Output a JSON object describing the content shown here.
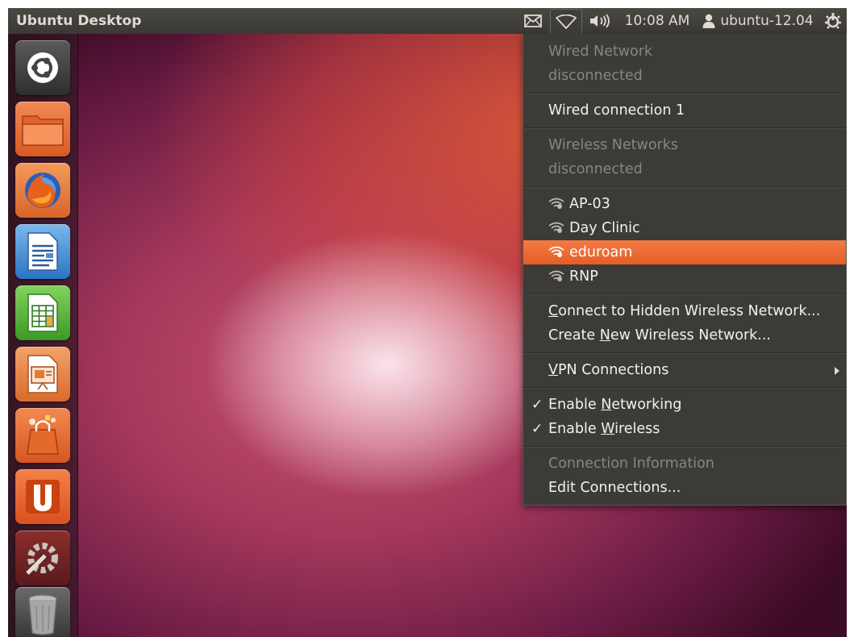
{
  "topbar": {
    "title": "Ubuntu Desktop",
    "clock": "10:08 AM",
    "user": "ubuntu-12.04",
    "icons": [
      "mail-icon",
      "wifi-icon",
      "volume-icon",
      "user-icon",
      "power-icon"
    ]
  },
  "launcher": {
    "items": [
      {
        "name": "dash-home",
        "icon": "ubuntu-logo-icon"
      },
      {
        "name": "home-folder",
        "icon": "folder-icon"
      },
      {
        "name": "firefox",
        "icon": "firefox-icon"
      },
      {
        "name": "libreoffice-writer",
        "icon": "writer-icon"
      },
      {
        "name": "libreoffice-calc",
        "icon": "calc-icon"
      },
      {
        "name": "libreoffice-impress",
        "icon": "impress-icon"
      },
      {
        "name": "software-center",
        "icon": "shopping-bag-icon"
      },
      {
        "name": "ubuntu-one",
        "icon": "ubuntu-one-icon"
      },
      {
        "name": "system-settings",
        "icon": "settings-icon"
      },
      {
        "name": "trash",
        "icon": "trash-icon"
      }
    ]
  },
  "menu": {
    "wired_header": "Wired Network",
    "wired_status": "disconnected",
    "wired_connection": "Wired connection 1",
    "wireless_header": "Wireless Networks",
    "wireless_status": "disconnected",
    "networks": [
      "AP-03",
      "Day Clinic",
      "eduroam",
      "RNP"
    ],
    "selected_network": "eduroam",
    "hidden_pre": "",
    "hidden_ul": "C",
    "hidden_post": "onnect to Hidden Wireless Network...",
    "create_pre": "Create ",
    "create_ul": "N",
    "create_post": "ew Wireless Network...",
    "vpn_pre": "",
    "vpn_ul": "V",
    "vpn_post": "PN Connections",
    "enable_net_pre": "Enable ",
    "enable_net_ul": "N",
    "enable_net_post": "etworking",
    "enable_wifi_pre": "Enable ",
    "enable_wifi_ul": "W",
    "enable_wifi_post": "ireless",
    "checkmark": "✓",
    "conn_info": "Connection Information",
    "edit_conn": "Edit Connections...",
    "colors": {
      "highlight": "#f07746",
      "menu_bg": "#3c3b37"
    }
  }
}
